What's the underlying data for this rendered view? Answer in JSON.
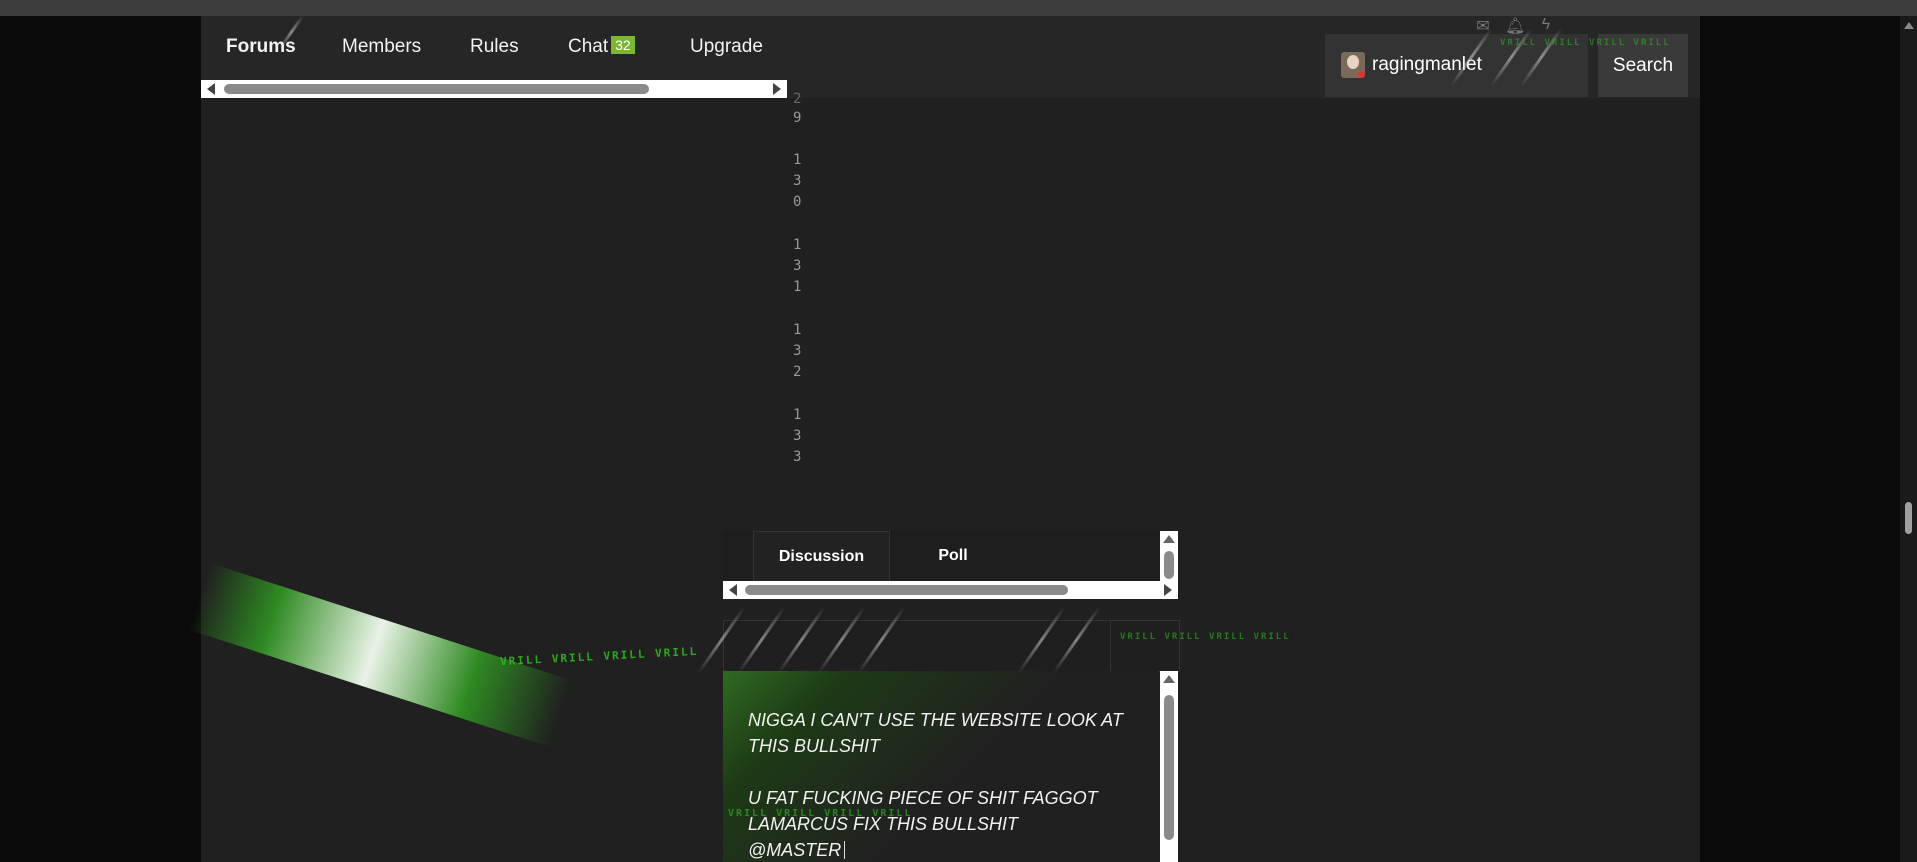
{
  "nav": {
    "items": [
      {
        "label": "Forums",
        "active": true
      },
      {
        "label": "Members"
      },
      {
        "label": "Rules"
      },
      {
        "label": "Chat",
        "badge": "32"
      },
      {
        "label": "Upgrade"
      }
    ]
  },
  "user": {
    "name": "ragingmanlet",
    "avatar_icon": "avatar-icon"
  },
  "search": {
    "label": "Search"
  },
  "top_icons": [
    "envelope-icon",
    "bell-icon",
    "lightning-icon"
  ],
  "line_numbers": [
    {
      "text": "9",
      "partial_above": "2"
    },
    {
      "text": "1\n3\n0"
    },
    {
      "text": "1\n3\n1"
    },
    {
      "text": "1\n3\n2"
    },
    {
      "text": "1\n3\n3"
    }
  ],
  "tabs": [
    {
      "label": "Discussion",
      "active": true
    },
    {
      "label": "Poll"
    }
  ],
  "editor": {
    "paragraph1": "NIGGA I CAN'T USE THE WEBSITE LOOK AT THIS BULLSHIT",
    "paragraph2": "U FAT FUCKING PIECE OF SHIT FAGGOT LAMARCUS FIX THIS BULLSHIT",
    "paragraph3": "@MASTER"
  },
  "decor": {
    "vrill_text": "VRILL VRILL VRILL VRILL",
    "accent_green": "#2fc21e",
    "badge_green": "#7cb82f"
  }
}
